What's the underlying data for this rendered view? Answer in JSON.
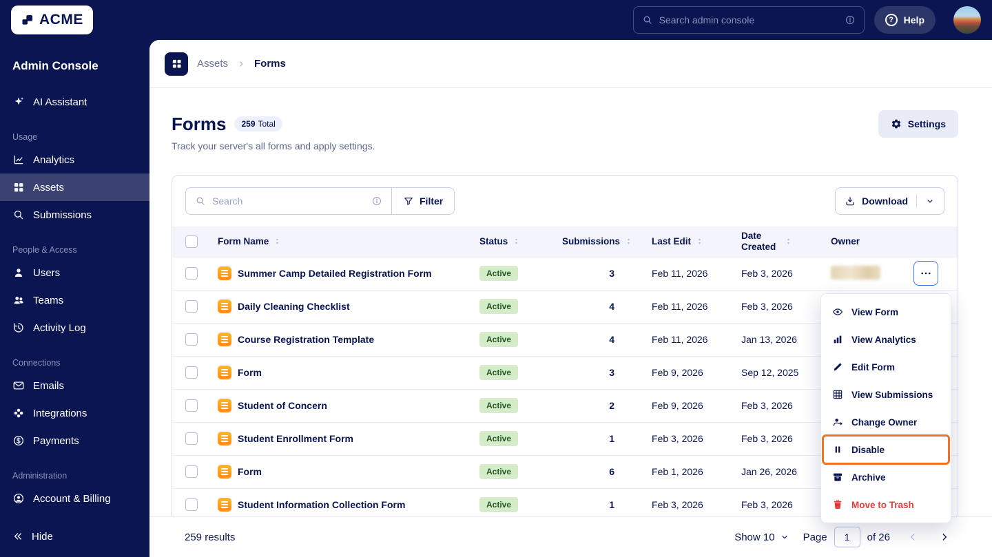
{
  "colors": {
    "navy": "#0a1551",
    "sidebar_active_bg": "#3b4271",
    "accent_blue": "#4277f5",
    "highlight_orange": "#ee7326",
    "badge_active_bg": "#d4ecc9",
    "badge_active_text": "#24591f",
    "danger_red": "#e23d3d",
    "form_icon_orange": "#ff8c1a"
  },
  "topbar": {
    "logo_text": "ACME",
    "search_placeholder": "Search admin console",
    "help_label": "Help"
  },
  "sidebar": {
    "title": "Admin Console",
    "ai_assistant": "AI Assistant",
    "hide_label": "Hide",
    "sections": [
      {
        "label": "Usage",
        "items": [
          {
            "label": "Analytics",
            "icon": "analytics-icon",
            "active": false
          },
          {
            "label": "Assets",
            "icon": "assets-icon",
            "active": true
          },
          {
            "label": "Submissions",
            "icon": "search-icon",
            "active": false
          }
        ]
      },
      {
        "label": "People & Access",
        "items": [
          {
            "label": "Users",
            "icon": "user-icon",
            "active": false
          },
          {
            "label": "Teams",
            "icon": "users-icon",
            "active": false
          },
          {
            "label": "Activity Log",
            "icon": "clock-icon",
            "active": false
          }
        ]
      },
      {
        "label": "Connections",
        "items": [
          {
            "label": "Emails",
            "icon": "mail-icon",
            "active": false
          },
          {
            "label": "Integrations",
            "icon": "integrations-icon",
            "active": false
          },
          {
            "label": "Payments",
            "icon": "payments-icon",
            "active": false
          }
        ]
      },
      {
        "label": "Administration",
        "items": [
          {
            "label": "Account & Billing",
            "icon": "account-icon",
            "active": false
          }
        ]
      }
    ]
  },
  "breadcrumb": {
    "parent": "Assets",
    "current": "Forms"
  },
  "page": {
    "title": "Forms",
    "total_count": "259",
    "total_label": "Total",
    "subtitle": "Track your server's all forms and apply settings.",
    "settings_label": "Settings"
  },
  "toolbar": {
    "search_placeholder": "Search",
    "filter_label": "Filter",
    "download_label": "Download"
  },
  "table": {
    "columns": [
      "Form Name",
      "Status",
      "Submissions",
      "Last Edit",
      "Date Created",
      "Owner"
    ],
    "rows": [
      {
        "name": "Summer Camp Detailed Registration Form",
        "status": "Active",
        "submissions": "3",
        "last_edit": "Feb 11, 2026",
        "date_created": "Feb 3, 2026",
        "owner_redacted": true,
        "menu_open": true
      },
      {
        "name": "Daily Cleaning Checklist",
        "status": "Active",
        "submissions": "4",
        "last_edit": "Feb 11, 2026",
        "date_created": "Feb 3, 2026",
        "owner_redacted": false,
        "menu_open": false
      },
      {
        "name": "Course Registration Template",
        "status": "Active",
        "submissions": "4",
        "last_edit": "Feb 11, 2026",
        "date_created": "Jan 13, 2026",
        "owner_redacted": false,
        "menu_open": false
      },
      {
        "name": "Form",
        "status": "Active",
        "submissions": "3",
        "last_edit": "Feb 9, 2026",
        "date_created": "Sep 12, 2025",
        "owner_redacted": false,
        "menu_open": false
      },
      {
        "name": "Student of Concern",
        "status": "Active",
        "submissions": "2",
        "last_edit": "Feb 9, 2026",
        "date_created": "Feb 3, 2026",
        "owner_redacted": false,
        "menu_open": false
      },
      {
        "name": "Student Enrollment Form",
        "status": "Active",
        "submissions": "1",
        "last_edit": "Feb 3, 2026",
        "date_created": "Feb 3, 2026",
        "owner_redacted": false,
        "menu_open": false
      },
      {
        "name": "Form",
        "status": "Active",
        "submissions": "6",
        "last_edit": "Feb 1, 2026",
        "date_created": "Jan 26, 2026",
        "owner_redacted": false,
        "menu_open": false
      },
      {
        "name": "Student Information Collection Form",
        "status": "Active",
        "submissions": "1",
        "last_edit": "Feb 3, 2026",
        "date_created": "Feb 3, 2026",
        "owner_redacted": false,
        "menu_open": false
      }
    ]
  },
  "context_menu": {
    "items": [
      {
        "label": "View Form",
        "icon": "eye-icon",
        "highlighted": false,
        "danger": false
      },
      {
        "label": "View Analytics",
        "icon": "bars-icon",
        "highlighted": false,
        "danger": false
      },
      {
        "label": "Edit Form",
        "icon": "pencil-icon",
        "highlighted": false,
        "danger": false
      },
      {
        "label": "View Submissions",
        "icon": "grid-icon",
        "highlighted": false,
        "danger": false
      },
      {
        "label": "Change Owner",
        "icon": "change-owner-icon",
        "highlighted": false,
        "danger": false
      },
      {
        "label": "Disable",
        "icon": "pause-icon",
        "highlighted": true,
        "danger": false
      },
      {
        "label": "Archive",
        "icon": "archive-icon",
        "highlighted": false,
        "danger": false
      },
      {
        "label": "Move to Trash",
        "icon": "trash-icon",
        "highlighted": false,
        "danger": true
      }
    ]
  },
  "footer": {
    "results": "259 results",
    "show_label": "Show 10",
    "page_label": "Page",
    "page_value": "1",
    "of_label": "of 26"
  }
}
